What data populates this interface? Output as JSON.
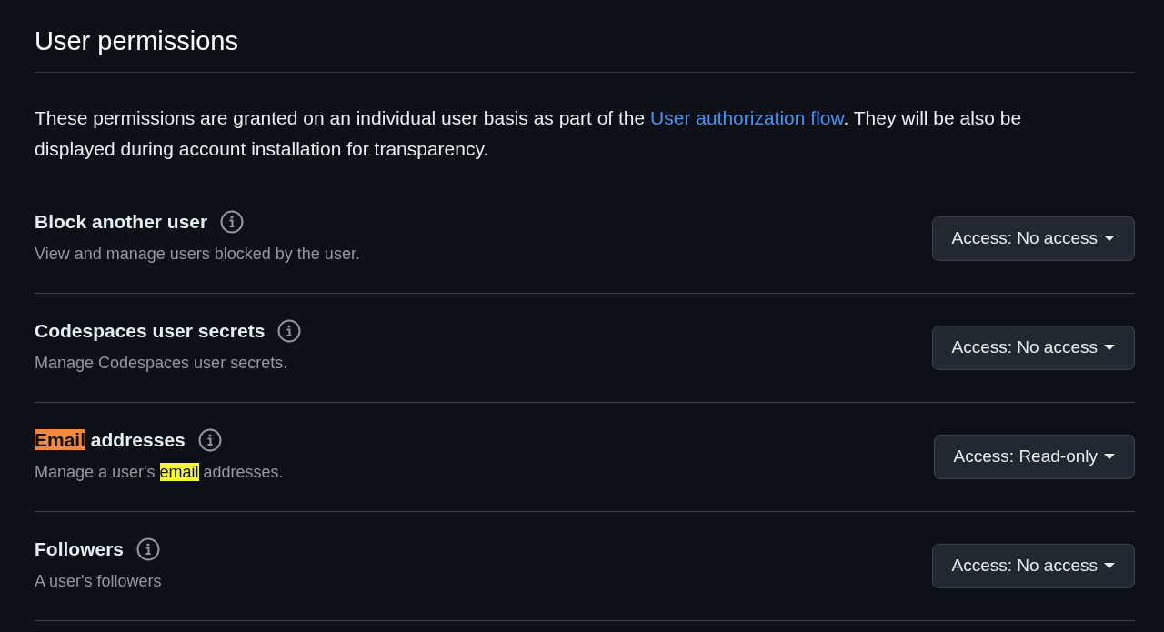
{
  "heading": "User permissions",
  "intro": {
    "before": "These permissions are granted on an individual user basis as part of the ",
    "link": "User authorization flow",
    "after": ". They will be also be displayed during account installation for transparency."
  },
  "permissions": [
    {
      "title": [
        {
          "text": "Block another user",
          "match": false,
          "current": false
        }
      ],
      "description": [
        {
          "text": "View and manage users blocked by the user.",
          "match": false,
          "current": false
        }
      ],
      "access": "Access: No access"
    },
    {
      "title": [
        {
          "text": "Codespaces user secrets",
          "match": false,
          "current": false
        }
      ],
      "description": [
        {
          "text": "Manage Codespaces user secrets.",
          "match": false,
          "current": false
        }
      ],
      "access": "Access: No access"
    },
    {
      "title": [
        {
          "text": "Email",
          "match": true,
          "current": true
        },
        {
          "text": " addresses",
          "match": false,
          "current": false
        }
      ],
      "description": [
        {
          "text": "Manage a user's ",
          "match": false,
          "current": false
        },
        {
          "text": "email",
          "match": true,
          "current": false
        },
        {
          "text": " addresses.",
          "match": false,
          "current": false
        }
      ],
      "access": "Access: Read-only"
    },
    {
      "title": [
        {
          "text": "Followers",
          "match": false,
          "current": false
        }
      ],
      "description": [
        {
          "text": "A user's followers",
          "match": false,
          "current": false
        }
      ],
      "access": "Access: No access"
    }
  ]
}
